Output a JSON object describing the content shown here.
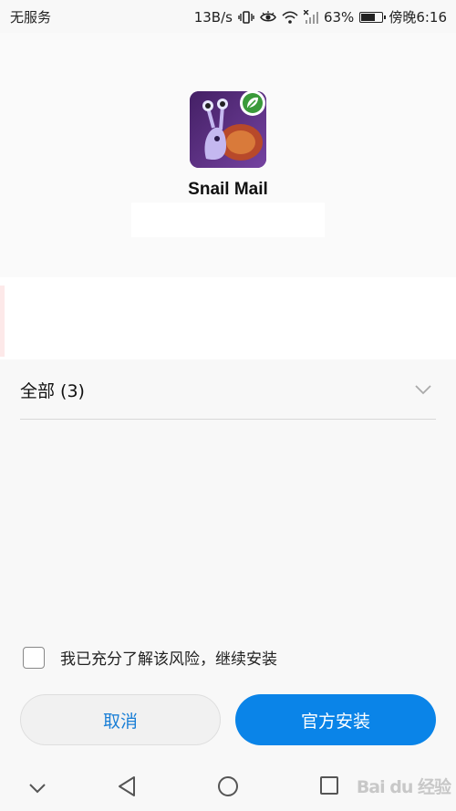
{
  "status_bar": {
    "carrier": "无服务",
    "net_speed": "13B/s",
    "battery_percent": "63%",
    "battery_level": 0.63,
    "time": "傍晚6:16",
    "icons": [
      "vibrate-icon",
      "eye-icon",
      "wifi-icon",
      "no-signal-icon",
      "battery-icon"
    ]
  },
  "app": {
    "name": "Snail Mail",
    "icon": "snail-mail-app-icon",
    "badge_icon": "verified-leaf-badge-icon"
  },
  "filter": {
    "label": "全部 (3)",
    "icon": "chevron-down-icon"
  },
  "agreement": {
    "checked": false,
    "label": "我已充分了解该风险，继续安装"
  },
  "buttons": {
    "cancel": "取消",
    "install": "官方安装"
  },
  "colors": {
    "primary": "#0a84e8",
    "cancel_text": "#1a7fd6",
    "background": "#f8f8f8"
  },
  "nav_bar": {
    "icons": [
      "collapse-down-icon",
      "back-icon",
      "home-icon",
      "recents-icon"
    ],
    "watermark": "Bai du 经验"
  }
}
